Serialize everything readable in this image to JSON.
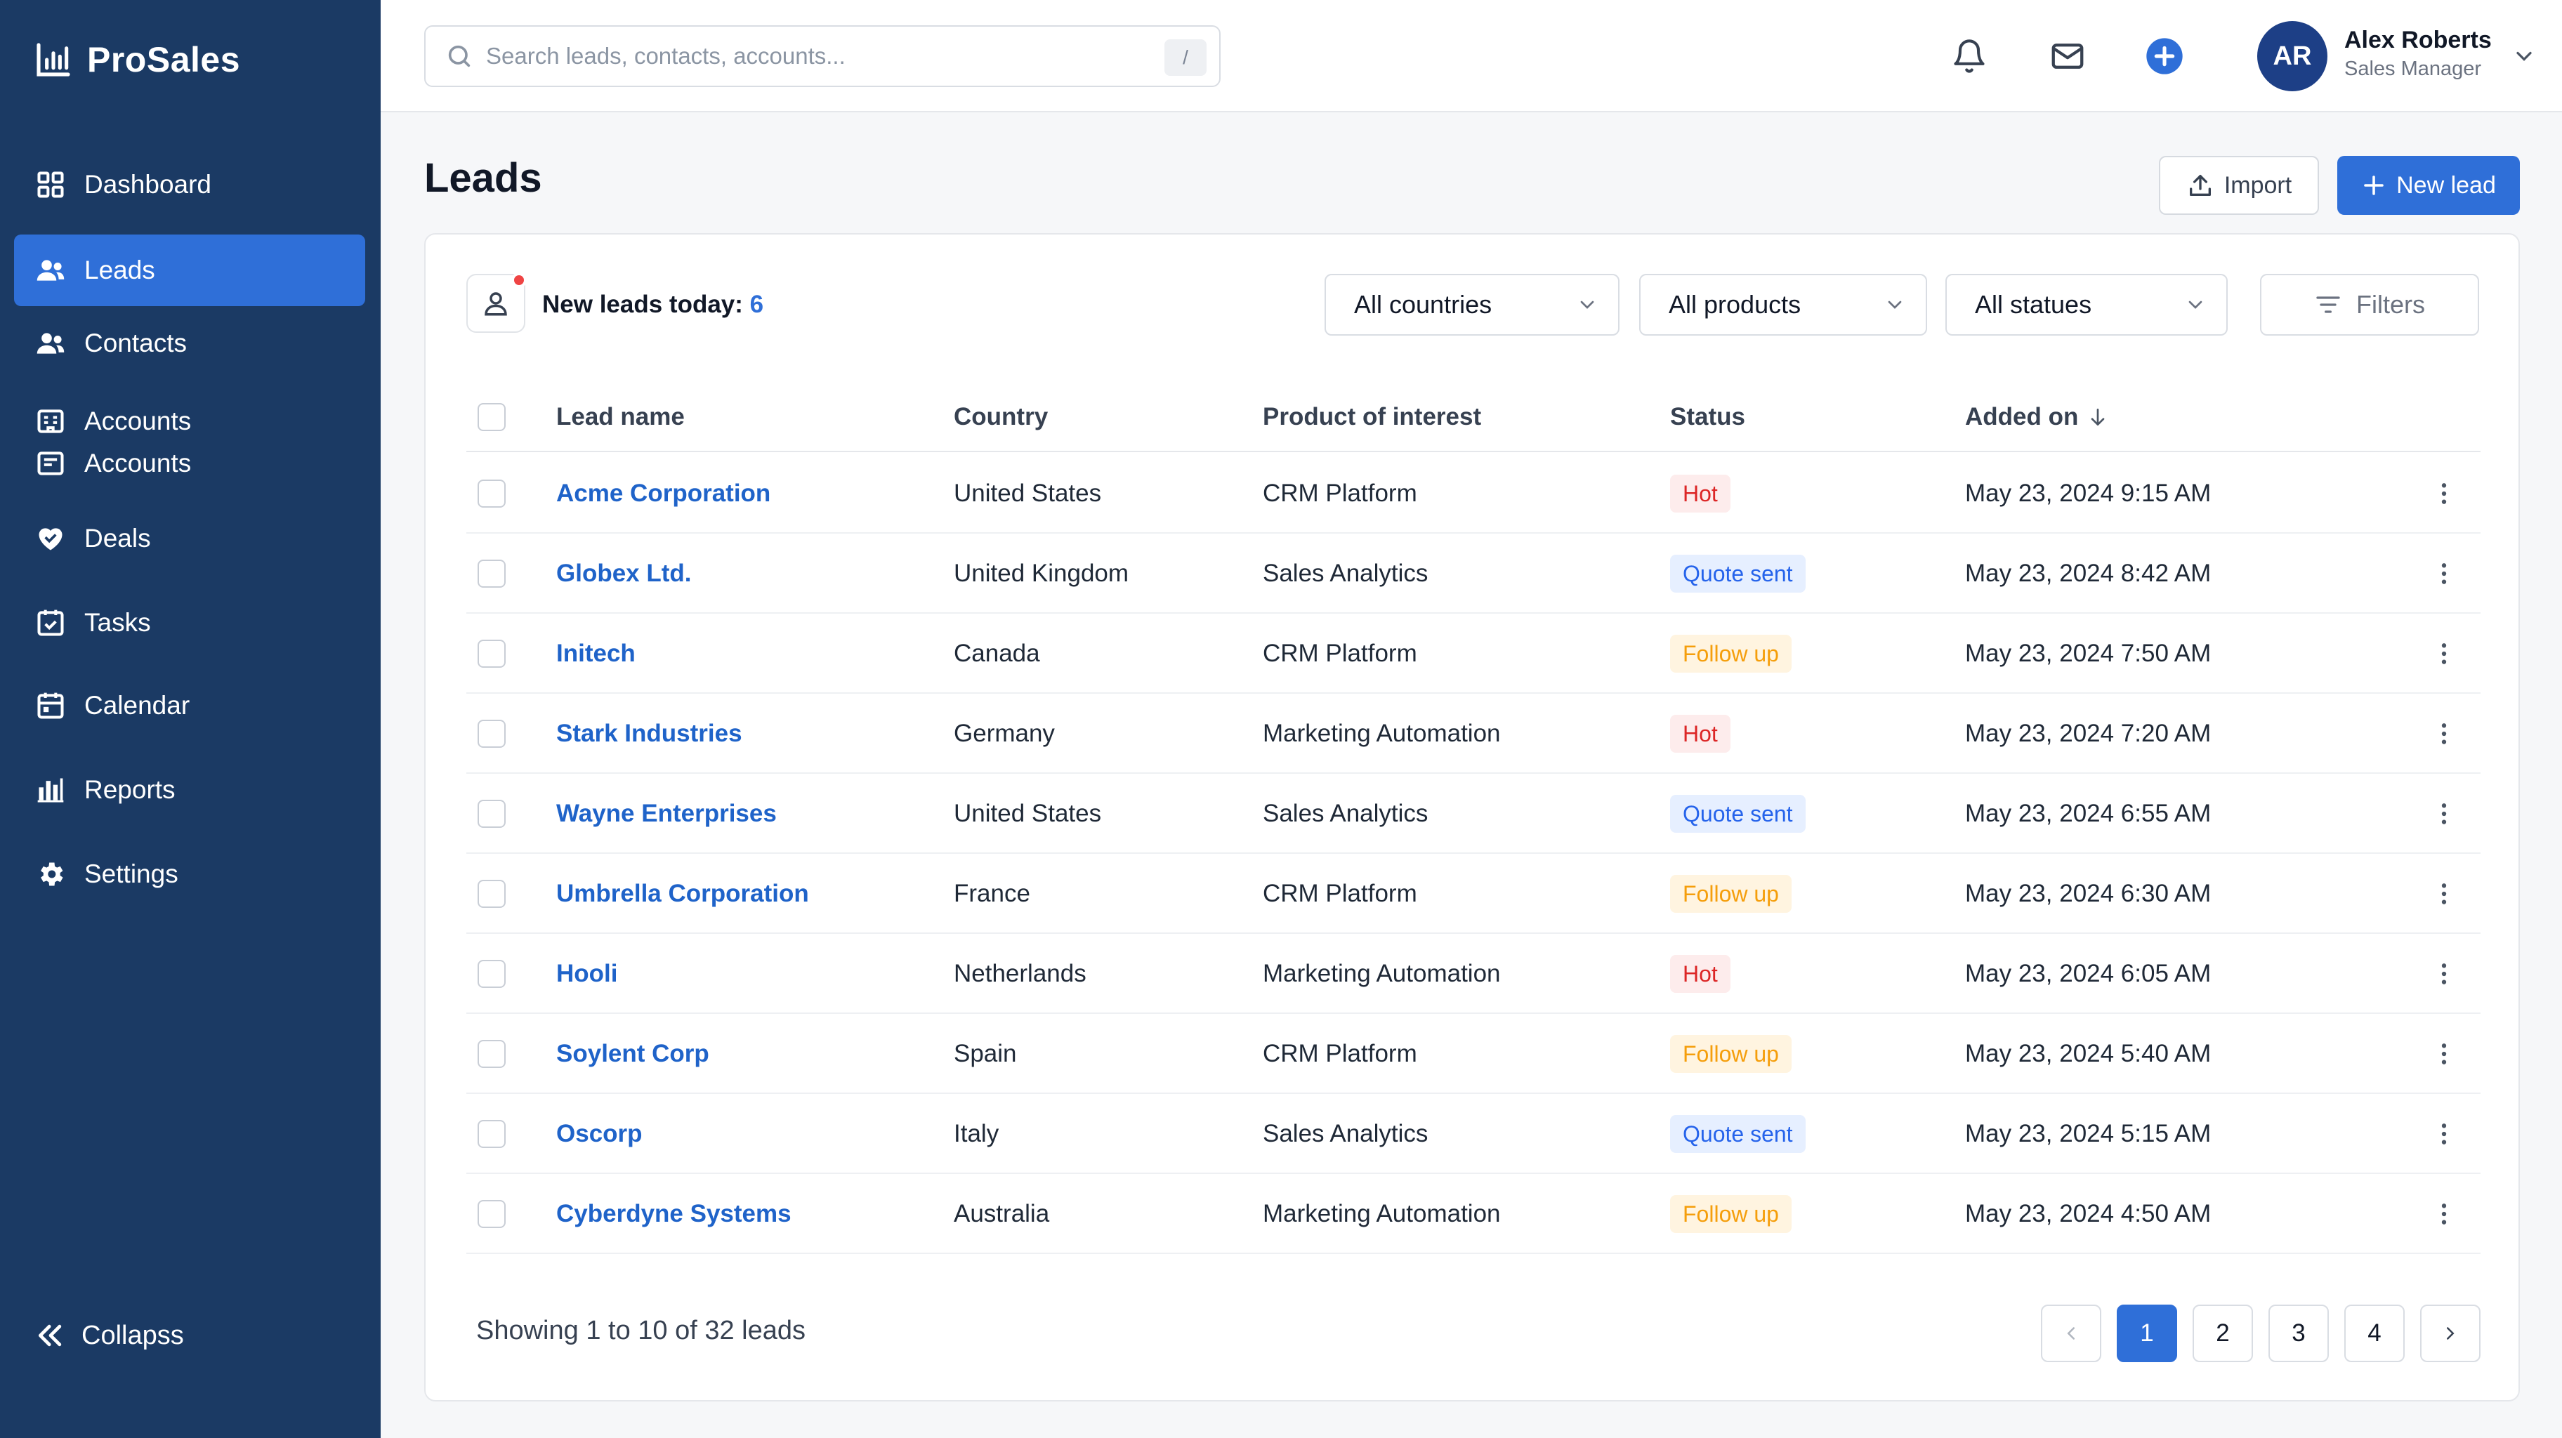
{
  "app": {
    "name": "ProSales",
    "logo_icon": "bar-chart-icon"
  },
  "sidebar": {
    "items": [
      {
        "label": "Dashboard",
        "icon": "grid-icon"
      },
      {
        "label": "Leads",
        "icon": "users-icon",
        "active": true
      },
      {
        "label": "Contacts",
        "icon": "contacts-icon"
      },
      {
        "label": "Accounts",
        "label2": "Accounts",
        "icon": "building-icon"
      },
      {
        "label": "Deals",
        "icon": "handshake-icon"
      },
      {
        "label": "Tasks",
        "icon": "check-square-icon"
      },
      {
        "label": "Calendar",
        "icon": "calendar-icon"
      },
      {
        "label": "Reports",
        "icon": "bar-chart-icon"
      },
      {
        "label": "Settings",
        "icon": "gear-icon"
      }
    ],
    "collapse_label": "Collapss"
  },
  "topbar": {
    "search_placeholder": "Search leads, contacts, accounts...",
    "search_shortcut": "/",
    "user": {
      "initials": "AR",
      "name": "Alex Roberts",
      "role": "Sales Manager"
    }
  },
  "page": {
    "title": "Leads",
    "import_label": "Import",
    "new_lead_label": "New lead"
  },
  "toolbar": {
    "new_leads_label": "New leads today:",
    "new_leads_count": "6",
    "country_filter": "All countries",
    "product_filter": "All products",
    "status_filter": "All statues",
    "filters_label": "Filters"
  },
  "table": {
    "headers": {
      "name": "Lead name",
      "country": "Country",
      "product": "Product of interest",
      "status": "Status",
      "added": "Added on"
    },
    "rows": [
      {
        "name": "Acme Corporation",
        "country": "United States",
        "product": "CRM Platform",
        "status": "Hot",
        "status_type": "hot",
        "added": "May 23, 2024 9:15 AM"
      },
      {
        "name": "Globex Ltd.",
        "country": "United Kingdom",
        "product": "Sales Analytics",
        "status": "Quote sent",
        "status_type": "quote",
        "added": "May 23, 2024 8:42 AM"
      },
      {
        "name": "Initech",
        "country": "Canada",
        "product": "CRM Platform",
        "status": "Follow up",
        "status_type": "follow",
        "added": "May 23, 2024 7:50 AM"
      },
      {
        "name": "Stark Industries",
        "country": "Germany",
        "product": "Marketing Automation",
        "status": "Hot",
        "status_type": "hot",
        "added": "May 23, 2024 7:20 AM"
      },
      {
        "name": "Wayne Enterprises",
        "country": "United States",
        "product": "Sales Analytics",
        "status": "Quote sent",
        "status_type": "quote",
        "added": "May 23, 2024 6:55 AM"
      },
      {
        "name": "Umbrella Corporation",
        "country": "France",
        "product": "CRM Platform",
        "status": "Follow up",
        "status_type": "follow",
        "added": "May 23, 2024 6:30 AM"
      },
      {
        "name": "Hooli",
        "country": "Netherlands",
        "product": "Marketing Automation",
        "status": "Hot",
        "status_type": "hot",
        "added": "May 23, 2024 6:05 AM"
      },
      {
        "name": "Soylent Corp",
        "country": "Spain",
        "product": "CRM Platform",
        "status": "Follow up",
        "status_type": "follow",
        "added": "May 23, 2024 5:40 AM"
      },
      {
        "name": "Oscorp",
        "country": "Italy",
        "product": "Sales Analytics",
        "status": "Quote sent",
        "status_type": "quote",
        "added": "May 23, 2024 5:15 AM"
      },
      {
        "name": "Cyberdyne Systems",
        "country": "Australia",
        "product": "Marketing Automation",
        "status": "Follow up",
        "status_type": "follow",
        "added": "May 23, 2024 4:50 AM"
      }
    ]
  },
  "footer": {
    "showing": "Showing 1 to 10 of 32 leads",
    "pages": [
      "1",
      "2",
      "3",
      "4"
    ],
    "current_page": "1"
  },
  "colors": {
    "sidebar": "#1b3a64",
    "accent": "#2f6fd8",
    "hot": "#dc2626",
    "quote": "#2563eb",
    "follow": "#f59e0b"
  }
}
